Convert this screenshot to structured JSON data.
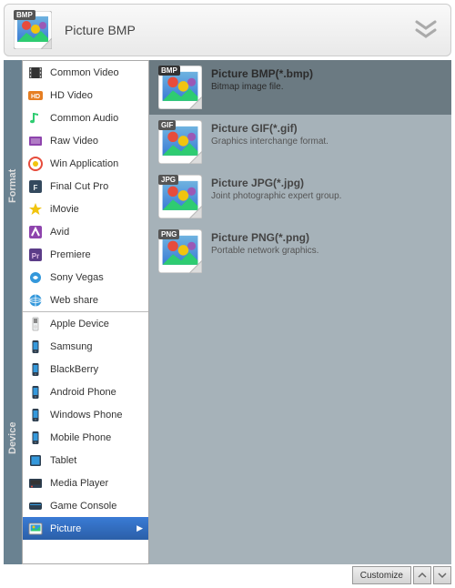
{
  "header": {
    "title": "Picture BMP",
    "badge": "BMP"
  },
  "sideTabs": {
    "top": "Format",
    "bottom": "Device"
  },
  "formatCategories": [
    {
      "id": "common-video",
      "label": "Common Video",
      "icon": "film"
    },
    {
      "id": "hd-video",
      "label": "HD Video",
      "icon": "hd"
    },
    {
      "id": "common-audio",
      "label": "Common Audio",
      "icon": "note"
    },
    {
      "id": "raw-video",
      "label": "Raw Video",
      "icon": "raw"
    },
    {
      "id": "win-app",
      "label": "Win Application",
      "icon": "win"
    },
    {
      "id": "final-cut",
      "label": "Final Cut Pro",
      "icon": "fcp"
    },
    {
      "id": "imovie",
      "label": "iMovie",
      "icon": "star"
    },
    {
      "id": "avid",
      "label": "Avid",
      "icon": "avid"
    },
    {
      "id": "premiere",
      "label": "Premiere",
      "icon": "pr"
    },
    {
      "id": "sony-vegas",
      "label": "Sony Vegas",
      "icon": "vegas"
    },
    {
      "id": "web-share",
      "label": "Web share",
      "icon": "globe"
    }
  ],
  "deviceCategories": [
    {
      "id": "apple-device",
      "label": "Apple Device",
      "icon": "ipod"
    },
    {
      "id": "samsung",
      "label": "Samsung",
      "icon": "phone"
    },
    {
      "id": "blackberry",
      "label": "BlackBerry",
      "icon": "phone"
    },
    {
      "id": "android",
      "label": "Android Phone",
      "icon": "phone"
    },
    {
      "id": "windows-phone",
      "label": "Windows Phone",
      "icon": "phone"
    },
    {
      "id": "mobile-phone",
      "label": "Mobile Phone",
      "icon": "phone"
    },
    {
      "id": "tablet",
      "label": "Tablet",
      "icon": "tablet"
    },
    {
      "id": "media-player",
      "label": "Media Player",
      "icon": "player"
    },
    {
      "id": "game-console",
      "label": "Game Console",
      "icon": "console"
    },
    {
      "id": "picture",
      "label": "Picture",
      "icon": "photo",
      "selected": true
    }
  ],
  "fileTypes": [
    {
      "badge": "BMP",
      "title": "Picture BMP(*.bmp)",
      "desc": "Bitmap image file.",
      "selected": true
    },
    {
      "badge": "GIF",
      "title": "Picture GIF(*.gif)",
      "desc": "Graphics interchange format."
    },
    {
      "badge": "JPG",
      "title": "Picture JPG(*.jpg)",
      "desc": "Joint photographic expert group."
    },
    {
      "badge": "PNG",
      "title": "Picture PNG(*.png)",
      "desc": "Portable network graphics."
    }
  ],
  "footer": {
    "customize": "Customize"
  }
}
